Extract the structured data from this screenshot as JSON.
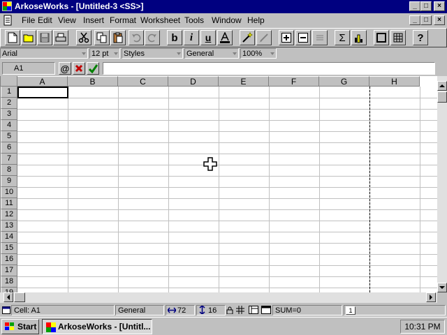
{
  "window": {
    "title": "ArkoseWorks - [Untitled-3 <SS>]",
    "caption_buttons": [
      "_",
      "□",
      "×"
    ],
    "doc_caption_buttons": [
      "_",
      "□",
      "×"
    ]
  },
  "menu": [
    "File",
    "Edit",
    "View",
    "Insert",
    "Format",
    "Worksheet",
    "Tools",
    "Window",
    "Help"
  ],
  "toolbar": {
    "bold_label": "b",
    "italic_label": "i",
    "underline_label": "u",
    "sum_label": "Σ",
    "help_label": "?"
  },
  "formatbar": {
    "font": "Arial",
    "size": "12 pt",
    "style": "Styles",
    "number_format": "General",
    "zoom": "100%"
  },
  "formulabar": {
    "cell_ref": "A1",
    "at_label": "@",
    "value": ""
  },
  "sheet": {
    "columns": [
      "A",
      "B",
      "C",
      "D",
      "E",
      "F",
      "G",
      "H"
    ],
    "rows": [
      "1",
      "2",
      "3",
      "4",
      "5",
      "6",
      "7",
      "8",
      "9",
      "10",
      "11",
      "12",
      "13",
      "14",
      "15",
      "16",
      "17",
      "18",
      "19"
    ],
    "active_cell": "A1"
  },
  "statusbar": {
    "cell": "Cell: A1",
    "format": "General",
    "width": "72",
    "height": "16",
    "sum": "SUM=0",
    "sheet_tab": "1"
  },
  "taskbar": {
    "start_label": "Start",
    "task_label": "ArkoseWorks - [Untitl...",
    "clock": "10:31 PM"
  },
  "colors": {
    "titlebar": "#000080",
    "face": "#c0c0c0",
    "grid": "#c0c0c0"
  }
}
